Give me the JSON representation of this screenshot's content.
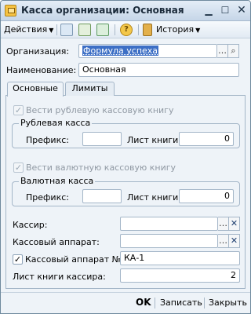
{
  "window": {
    "title": "Касса организации: Основная"
  },
  "toolbar": {
    "actions_label": "Действия",
    "history_label": "История",
    "icons": [
      "new-document-icon",
      "copy-icon",
      "refresh-icon",
      "help-icon",
      "history-icon"
    ]
  },
  "form": {
    "organization_label": "Организация:",
    "organization_value": "Формула успеха",
    "name_label": "Наименование:",
    "name_value": "Основная"
  },
  "tabs": [
    {
      "label": "Основные",
      "active": true
    },
    {
      "label": "Лимиты",
      "active": false
    }
  ],
  "main": {
    "ruble_book_label": "Вести рублевую кассовую книгу",
    "ruble_book_checked": true,
    "ruble_group": {
      "title": "Рублевая касса",
      "prefix_label": "Префикс:",
      "prefix_value": "",
      "sheet_label": "Лист книги:",
      "sheet_value": "0"
    },
    "currency_book_label": "Вести валютную кассовую книгу",
    "currency_book_checked": true,
    "currency_group": {
      "title": "Валютная касса",
      "prefix_label": "Префикс:",
      "prefix_value": "",
      "sheet_label": "Лист книги:",
      "sheet_value": "0"
    },
    "cashier_label": "Кассир:",
    "cashier_value": "",
    "register_label": "Кассовый аппарат:",
    "register_value": "",
    "register_no_label": "Кассовый аппарат №:",
    "register_no_checked": true,
    "register_no_value": "КА-1",
    "cashier_sheet_label": "Лист книги кассира:",
    "cashier_sheet_value": "2"
  },
  "footer": {
    "ok": "OK",
    "save": "Записать",
    "close": "Закрыть"
  },
  "colors": {
    "accent": "#3d6fc5",
    "window_bg": "#eef3f8",
    "border": "#a4b6c8"
  }
}
